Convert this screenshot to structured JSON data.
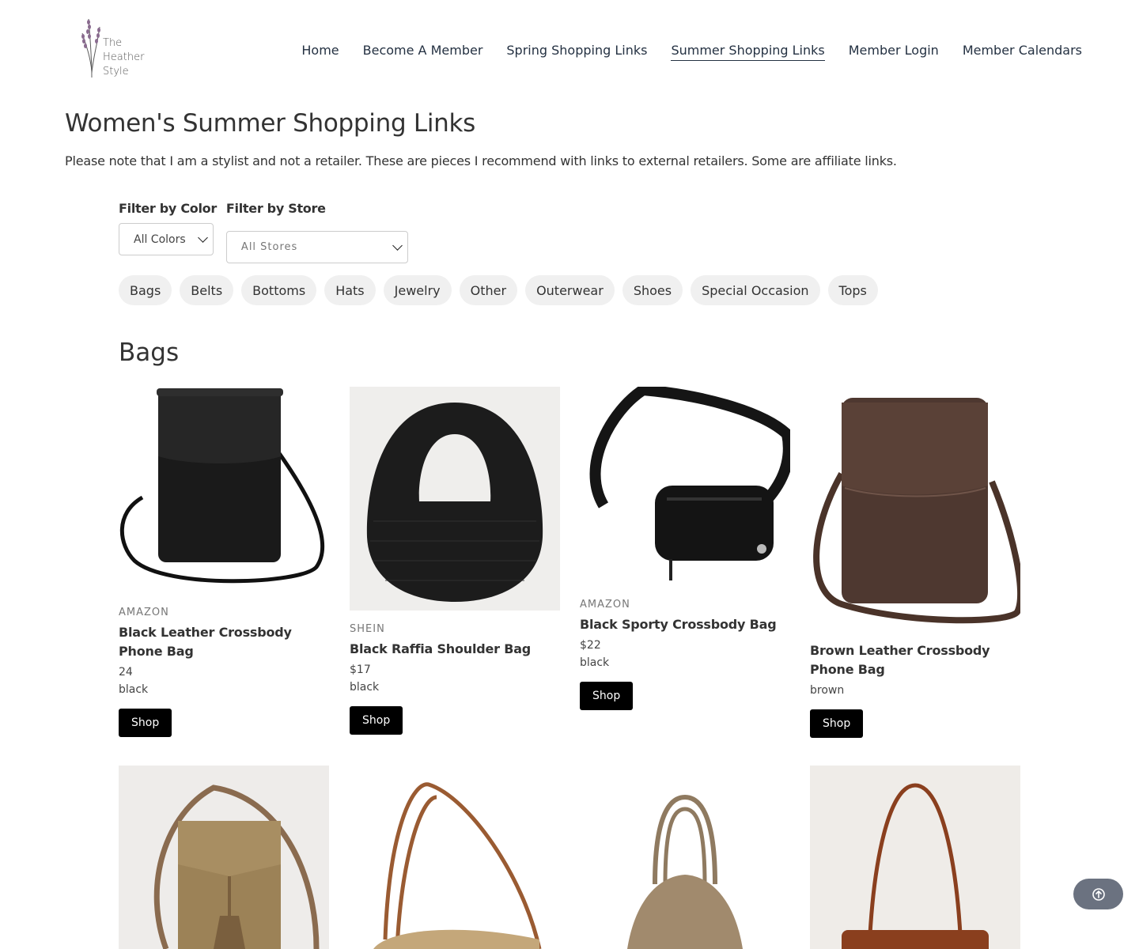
{
  "brand": {
    "line1": "The",
    "line2": "Heather",
    "line3": "Style"
  },
  "nav": [
    {
      "label": "Home"
    },
    {
      "label": "Become A Member"
    },
    {
      "label": "Spring Shopping Links"
    },
    {
      "label": "Summer Shopping Links",
      "active": true
    },
    {
      "label": "Member Login"
    },
    {
      "label": "Member Calendars"
    }
  ],
  "page": {
    "title": "Women's Summer Shopping Links",
    "disclaimer": "Please note that I am a stylist and not a retailer. These are pieces I recommend with links to external retailers. Some are affiliate links."
  },
  "filters": {
    "color_label": "Filter by Color",
    "color_value": "All Colors",
    "store_label": "Filter by Store",
    "store_value": "All Stores"
  },
  "categories": [
    "Bags",
    "Belts",
    "Bottoms",
    "Hats",
    "Jewelry",
    "Other",
    "Outerwear",
    "Shoes",
    "Special Occasion",
    "Tops"
  ],
  "section": {
    "title": "Bags"
  },
  "products": [
    {
      "store": "AMAZON",
      "name": "Black Leather Crossbody Phone Bag",
      "price": "24",
      "color": "black",
      "button": "Shop"
    },
    {
      "store": "SHEIN",
      "name": "Black Raffia Shoulder Bag",
      "price": "$17",
      "color": "black",
      "button": "Shop"
    },
    {
      "store": "AMAZON",
      "name": "Black Sporty Crossbody Bag",
      "price": "$22",
      "color": "black",
      "button": "Shop"
    },
    {
      "store": "",
      "name": "Brown Leather Crossbody Phone Bag",
      "price": "",
      "color": "brown",
      "button": "Shop"
    }
  ],
  "icons": {
    "scroll_top": "arrow-up-circle-icon"
  },
  "colors": {
    "nav_text": "#243142",
    "button_bg": "#000000",
    "chip_bg": "#f0f0f0"
  }
}
